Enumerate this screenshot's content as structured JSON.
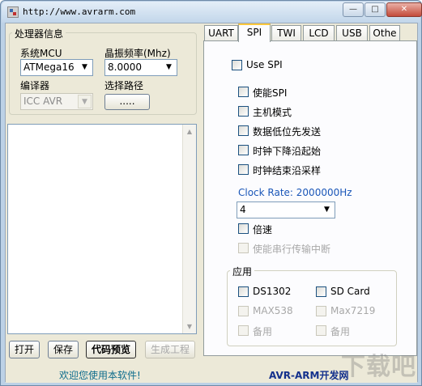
{
  "window": {
    "title": "http://www.avrarm.com",
    "buttons": {
      "minimize": "—",
      "maximize": "□",
      "close": "✕"
    }
  },
  "processor_group": {
    "title": "处理器信息",
    "mcu_label": "系统MCU",
    "mcu_value": "ATMega16",
    "freq_label": "晶振频率(Mhz)",
    "freq_value": "8.0000",
    "compiler_label": "编译器",
    "compiler_value": "ICC AVR",
    "path_label": "选择路径",
    "path_button": "....."
  },
  "bottom_buttons": {
    "open": "打开",
    "save": "保存",
    "preview": "代码预览",
    "generate": "生成工程"
  },
  "tabs": [
    {
      "label": "UART",
      "active": false
    },
    {
      "label": "SPI",
      "active": true
    },
    {
      "label": "TWI",
      "active": false
    },
    {
      "label": "LCD",
      "active": false
    },
    {
      "label": "USB",
      "active": false
    },
    {
      "label": "Othe",
      "active": false
    }
  ],
  "spi_panel": {
    "use_spi": "Use SPI",
    "options": [
      "使能SPI",
      "主机模式",
      "数据低位先发送",
      "时钟下降沿起始",
      "时钟结束沿采样"
    ],
    "clock_rate_label": "Clock Rate: 2000000Hz",
    "clock_divider_value": "4",
    "double_speed": "倍速",
    "serial_interrupt": "使能串行传输中断"
  },
  "application_group": {
    "title": "应用",
    "items": [
      {
        "label": "DS1302",
        "enabled": true
      },
      {
        "label": "SD Card",
        "enabled": true
      },
      {
        "label": "MAX538",
        "enabled": false
      },
      {
        "label": "Max7219",
        "enabled": false
      },
      {
        "label": "备用",
        "enabled": false
      },
      {
        "label": "备用",
        "enabled": false
      }
    ]
  },
  "status_bar": {
    "welcome": "欢迎您使用本软件!",
    "brand": "AVR-ARM开发网"
  },
  "watermark": "下载吧",
  "colors": {
    "client_background": "#ece9d8",
    "clock_rate_text": "#1a56b8",
    "status_welcome": "#0e6c8c",
    "status_brand": "#13308c",
    "active_tab_accent": "#ffc83c"
  }
}
